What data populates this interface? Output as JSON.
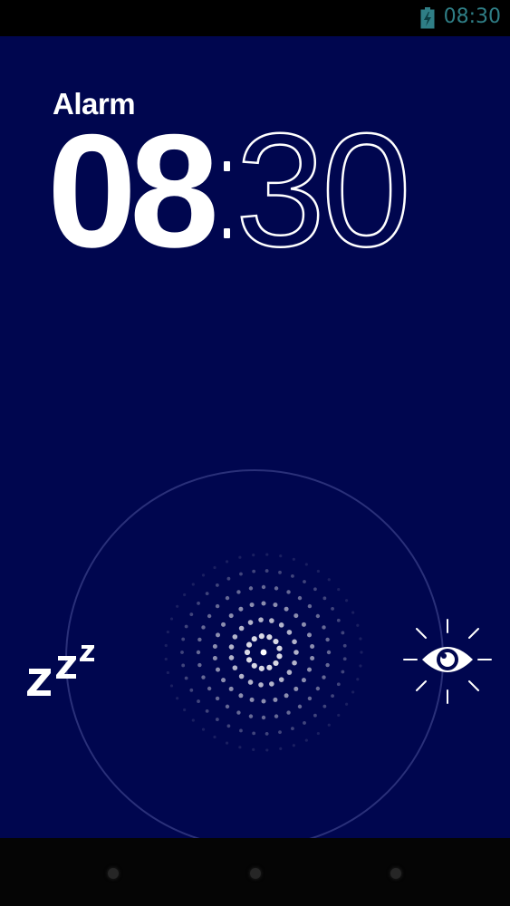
{
  "status_bar": {
    "time": "08:30",
    "time_color": "#2f7e86",
    "battery_icon": "battery-charging-icon"
  },
  "alarm": {
    "label": "Alarm",
    "hours": "08",
    "minutes": "30",
    "background_color": "#00064f"
  },
  "actions": {
    "snooze_icon": "snooze-zzz-icon",
    "dismiss_icon": "eye-icon",
    "drag_handle_icon": "dotted-glow-handle"
  },
  "nav_bar": {
    "buttons": [
      "back-dot",
      "home-dot",
      "recents-dot"
    ]
  }
}
